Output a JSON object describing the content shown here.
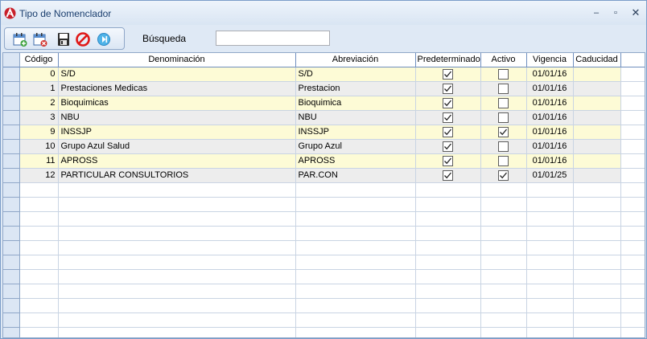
{
  "window": {
    "title": "Tipo de Nomenclador",
    "icons": {
      "app": "app-logo-icon",
      "minimize": "minimize-icon",
      "maximize": "maximize-icon",
      "close": "close-icon"
    },
    "controls": {
      "minimize": "–",
      "maximize": "▫",
      "close": "✕"
    }
  },
  "toolbar": {
    "buttons": [
      {
        "name": "new-record-icon"
      },
      {
        "name": "delete-record-icon"
      },
      {
        "name": "save-icon"
      },
      {
        "name": "cancel-icon"
      },
      {
        "name": "exit-icon"
      }
    ],
    "search_label": "Búsqueda",
    "search_value": ""
  },
  "grid": {
    "columns": [
      "Código",
      "Denominación",
      "Abreviación",
      "Predeterminado",
      "Activo",
      "Vigencia",
      "Caducidad"
    ],
    "rows": [
      {
        "codigo": "0",
        "denominacion": "S/D",
        "abreviacion": "S/D",
        "predeterminado": true,
        "activo": false,
        "vigencia": "01/01/16",
        "caducidad": ""
      },
      {
        "codigo": "1",
        "denominacion": "Prestaciones Medicas",
        "abreviacion": "Prestacion",
        "predeterminado": true,
        "activo": false,
        "vigencia": "01/01/16",
        "caducidad": ""
      },
      {
        "codigo": "2",
        "denominacion": "Bioquimicas",
        "abreviacion": "Bioquimica",
        "predeterminado": true,
        "activo": false,
        "vigencia": "01/01/16",
        "caducidad": ""
      },
      {
        "codigo": "3",
        "denominacion": "NBU",
        "abreviacion": "NBU",
        "predeterminado": true,
        "activo": false,
        "vigencia": "01/01/16",
        "caducidad": ""
      },
      {
        "codigo": "9",
        "denominacion": "INSSJP",
        "abreviacion": "INSSJP",
        "predeterminado": true,
        "activo": true,
        "vigencia": "01/01/16",
        "caducidad": ""
      },
      {
        "codigo": "10",
        "denominacion": "Grupo Azul Salud",
        "abreviacion": "Grupo Azul",
        "predeterminado": true,
        "activo": false,
        "vigencia": "01/01/16",
        "caducidad": ""
      },
      {
        "codigo": "11",
        "denominacion": "APROSS",
        "abreviacion": "APROSS",
        "predeterminado": true,
        "activo": false,
        "vigencia": "01/01/16",
        "caducidad": ""
      },
      {
        "codigo": "12",
        "denominacion": "PARTICULAR CONSULTORIOS",
        "abreviacion": "PAR.CON",
        "predeterminado": true,
        "activo": true,
        "vigencia": "01/01/25",
        "caducidad": ""
      }
    ],
    "empty_rows": 11
  },
  "colors": {
    "row_yellow": "#fdfbd6",
    "row_gray": "#ededed",
    "header_border": "#6f8fbf",
    "title_text": "#1a3e6e"
  }
}
